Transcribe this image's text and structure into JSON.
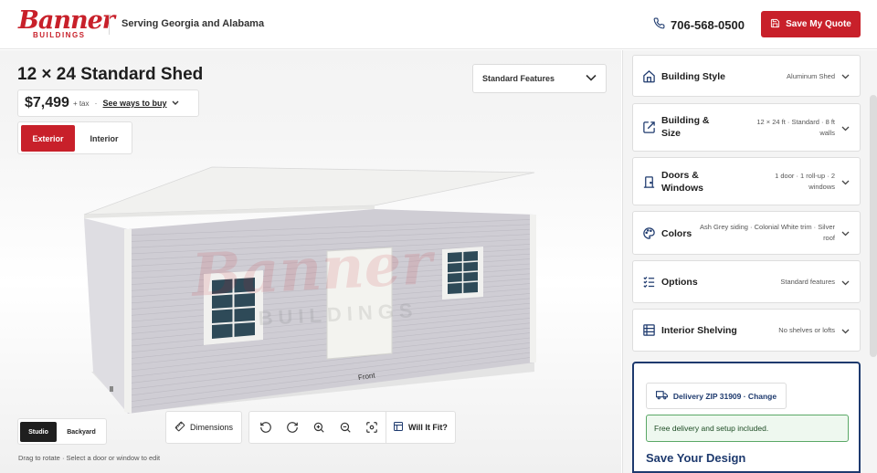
{
  "header": {
    "logo_word": "Banner",
    "logo_sub": "BUILDINGS",
    "serving": "Serving Georgia and Alabama",
    "phone": "706-568-0500",
    "save_quote": "Save My Quote",
    "accent": "#c8202a"
  },
  "product": {
    "title": "12 × 24 Standard Shed",
    "price": "$7,499",
    "price_tax": "+ tax",
    "price_dot": "·",
    "see_ways": "See ways to buy",
    "standard_features": "Standard Features"
  },
  "view_tabs": {
    "exterior": "Exterior",
    "interior": "Interior",
    "active": "Exterior"
  },
  "scene": {
    "watermark_word": "Banner",
    "watermark_sub": "BUILDINGS",
    "front_label": "Front",
    "siding_color": "#cfcdd4",
    "trim_color": "#f1f1ef",
    "window_glass": "#2e4a58"
  },
  "mode_tabs": {
    "studio": "Studio",
    "backyard": "Backyard",
    "active": "Studio"
  },
  "tools": {
    "dimensions": "Dimensions",
    "icons": [
      "rotate-left-icon",
      "rotate-right-icon",
      "zoom-in-icon",
      "zoom-out-icon",
      "recenter-icon"
    ],
    "will_it_fit": "Will It Fit?"
  },
  "hint": "Drag to rotate · Select a door or window to edit",
  "options": [
    {
      "label": "Building Style",
      "value": "Aluminum Shed",
      "icon": "house-icon"
    },
    {
      "label": "Building & Size",
      "value": "12 × 24 ft · Standard · 8 ft walls",
      "icon": "resize-icon"
    },
    {
      "label": "Doors & Windows",
      "value": "1 door · 1 roll-up · 2 windows",
      "icon": "door-icon"
    },
    {
      "label": "Colors",
      "value": "Ash Grey siding · Colonial White trim · Silver roof",
      "icon": "palette-icon"
    },
    {
      "label": "Options",
      "value": "Standard features",
      "icon": "checklist-icon"
    },
    {
      "label": "Interior Shelving",
      "value": "No shelves or lofts",
      "icon": "shelving-icon"
    }
  ],
  "delivery": {
    "zip_label": "Delivery ZIP 31909 · Change",
    "free_note": "Free delivery and setup included.",
    "save_design": "Save Your Design",
    "accent": "#1e3a6e"
  }
}
